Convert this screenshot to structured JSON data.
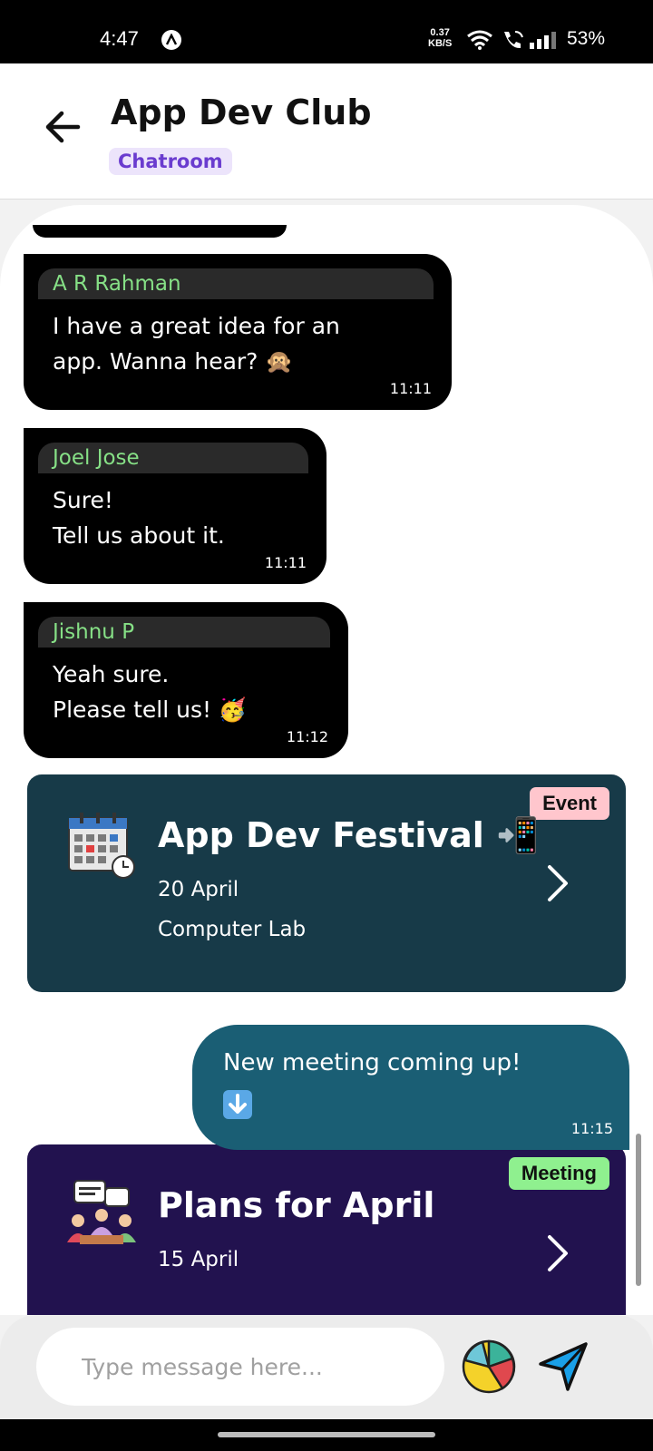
{
  "status_bar": {
    "time": "4:47",
    "net_speed_value": "0.37",
    "net_speed_unit": "KB/S",
    "battery": "53%"
  },
  "header": {
    "title": "App Dev Club",
    "chip": "Chatroom"
  },
  "messages": [
    {
      "sender": "A R Rahman",
      "text": "I have a great idea for an\napp. Wanna hear? 🙊",
      "time": "11:11"
    },
    {
      "sender": "Joel Jose",
      "text": "Sure!\nTell us about it.",
      "time": "11:11"
    },
    {
      "sender": "Jishnu P",
      "text": "Yeah sure.\nPlease tell us! 🥳",
      "time": "11:12"
    }
  ],
  "event_card": {
    "badge": "Event",
    "title": "App Dev Festival 📲",
    "date": "20 April",
    "place": "Computer Lab",
    "color": "#173a48",
    "badge_color": "#ffc6cd"
  },
  "own_message": {
    "text": "New meeting coming up!",
    "time": "11:15"
  },
  "meeting_card": {
    "badge": "Meeting",
    "title": "Plans for April",
    "date": "15 April",
    "color": "#22124f",
    "badge_color": "#8ff08f"
  },
  "input": {
    "placeholder": "Type message here..."
  }
}
